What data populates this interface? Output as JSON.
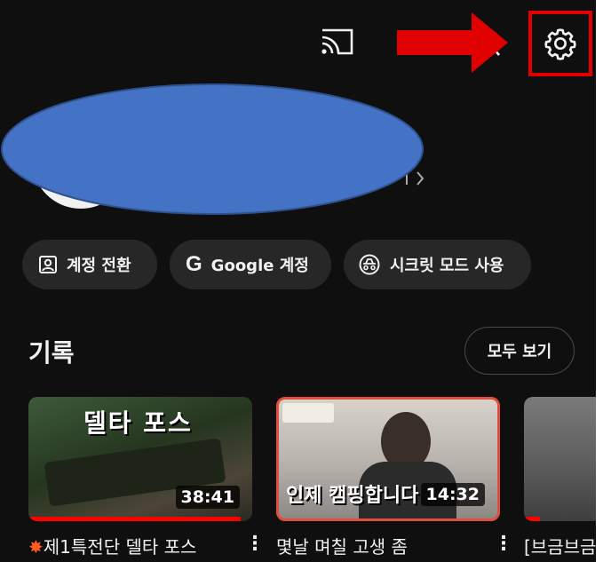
{
  "header": {
    "cast_icon": "cast-icon",
    "settings_icon": "gear-icon"
  },
  "account": {
    "switch_label": "계정 전환",
    "google_account_label": "Google 계정",
    "incognito_label": "시크릿 모드 사용"
  },
  "history": {
    "title": "기록",
    "view_all_label": "모두 보기",
    "videos": [
      {
        "thumb_text": "델타 포스",
        "duration": "38:41",
        "title": "제1특전단 델타 포스",
        "progress": 0.95
      },
      {
        "thumb_text": "인제 캠핑합니다",
        "duration": "14:32",
        "title": "몇날 며칠 고생 좀",
        "progress": 0.0
      },
      {
        "title": "[브금브금",
        "progress": 0.15
      }
    ]
  },
  "colors": {
    "background": "#0f0f0f",
    "chip": "#272727",
    "annotation_red": "#e00000",
    "redaction_blue": "#4472c4",
    "progress_red": "#ff0000"
  }
}
